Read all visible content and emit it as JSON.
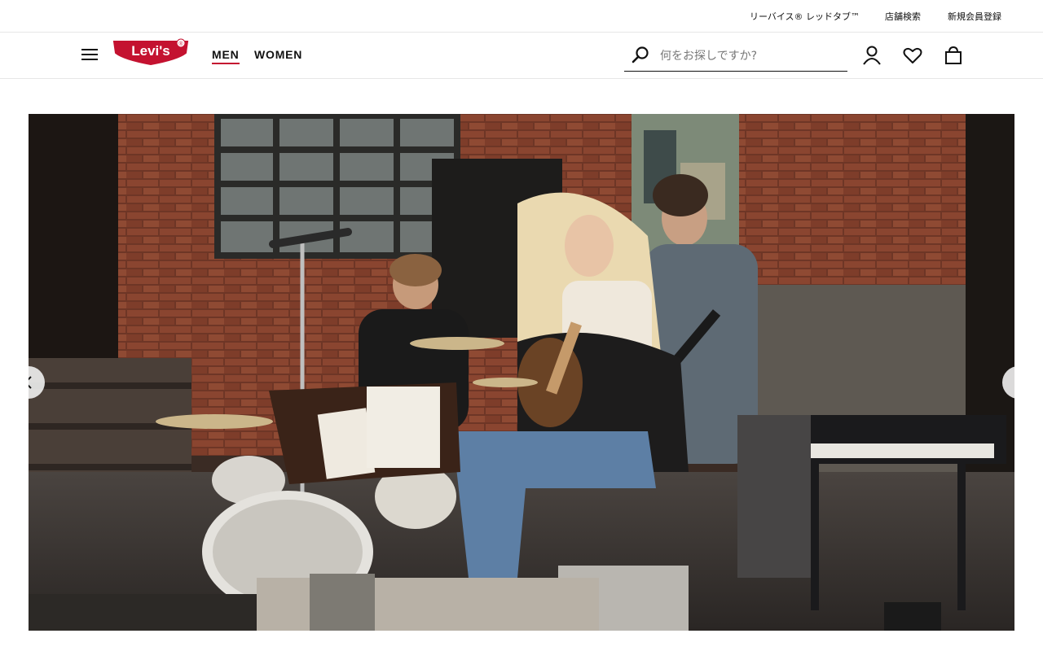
{
  "utility": {
    "red_tab": "リーバイス® レッドタブ™",
    "store_locator": "店舗検索",
    "register": "新規会員登録"
  },
  "brand": {
    "logo_text": "Levi's",
    "logo_mark": "®",
    "brand_red": "#c41230"
  },
  "nav": {
    "men": "MEN",
    "women": "WOMEN",
    "active": "MEN"
  },
  "search": {
    "placeholder": "何をお探しですか?"
  },
  "icons": {
    "menu": "hamburger-menu-icon",
    "search": "search-icon",
    "account": "account-icon",
    "wishlist": "heart-icon",
    "bag": "shopping-bag-icon",
    "prev": "chevron-left-icon",
    "next": "chevron-right-icon"
  },
  "hero": {
    "image_alt": "Band rehearsal in brick-walled studio"
  }
}
